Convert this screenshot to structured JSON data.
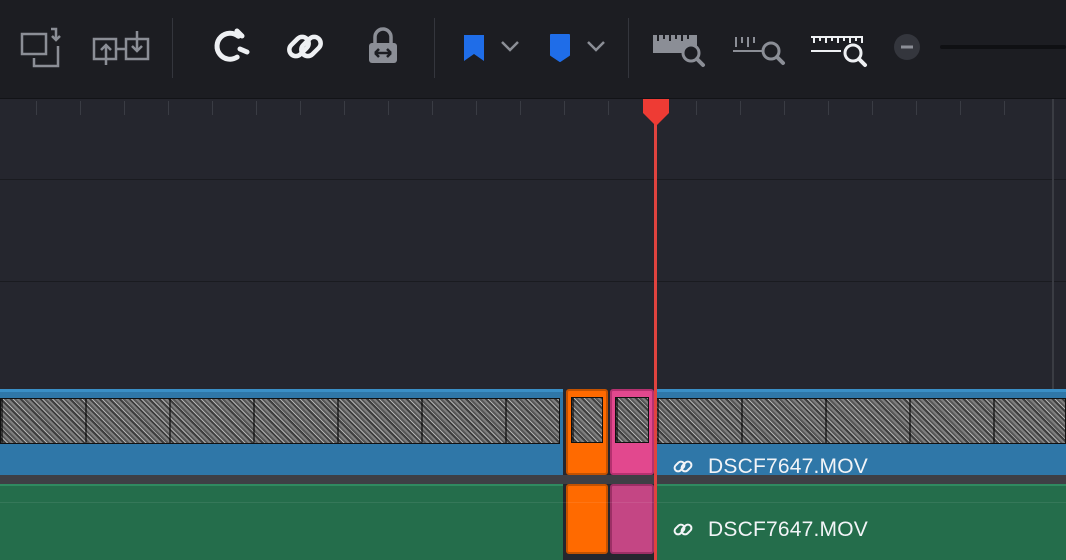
{
  "toolbar": {
    "tools": [
      {
        "id": "selection-mode",
        "icon": "timeline-view-options-icon"
      },
      {
        "id": "replace-clip",
        "icon": "overwrite-swap-icon"
      },
      {
        "id": "snapping",
        "icon": "magnet-icon"
      },
      {
        "id": "linked-selection",
        "icon": "link-icon"
      },
      {
        "id": "position-lock",
        "icon": "lock-icon"
      },
      {
        "id": "flag",
        "icon": "flag-icon",
        "color": "#1f6de8"
      },
      {
        "id": "marker",
        "icon": "marker-icon",
        "color": "#1f6de8"
      },
      {
        "id": "zoom-full",
        "icon": "zoom-full-icon"
      },
      {
        "id": "zoom-detail",
        "icon": "zoom-detail-icon"
      },
      {
        "id": "zoom-custom",
        "icon": "zoom-custom-icon"
      }
    ],
    "zoom_out_icon": "minus-icon"
  },
  "timeline": {
    "playhead_color": "#e0433f",
    "video_clip": {
      "name": "DSCF7647.MOV",
      "color": "#2f77a8"
    },
    "audio_clip": {
      "name": "DSCF7647.MOV",
      "color": "#246d4b"
    },
    "inserted_clips": [
      {
        "color": "#ff6a00"
      },
      {
        "color": "#e2488e"
      }
    ]
  }
}
